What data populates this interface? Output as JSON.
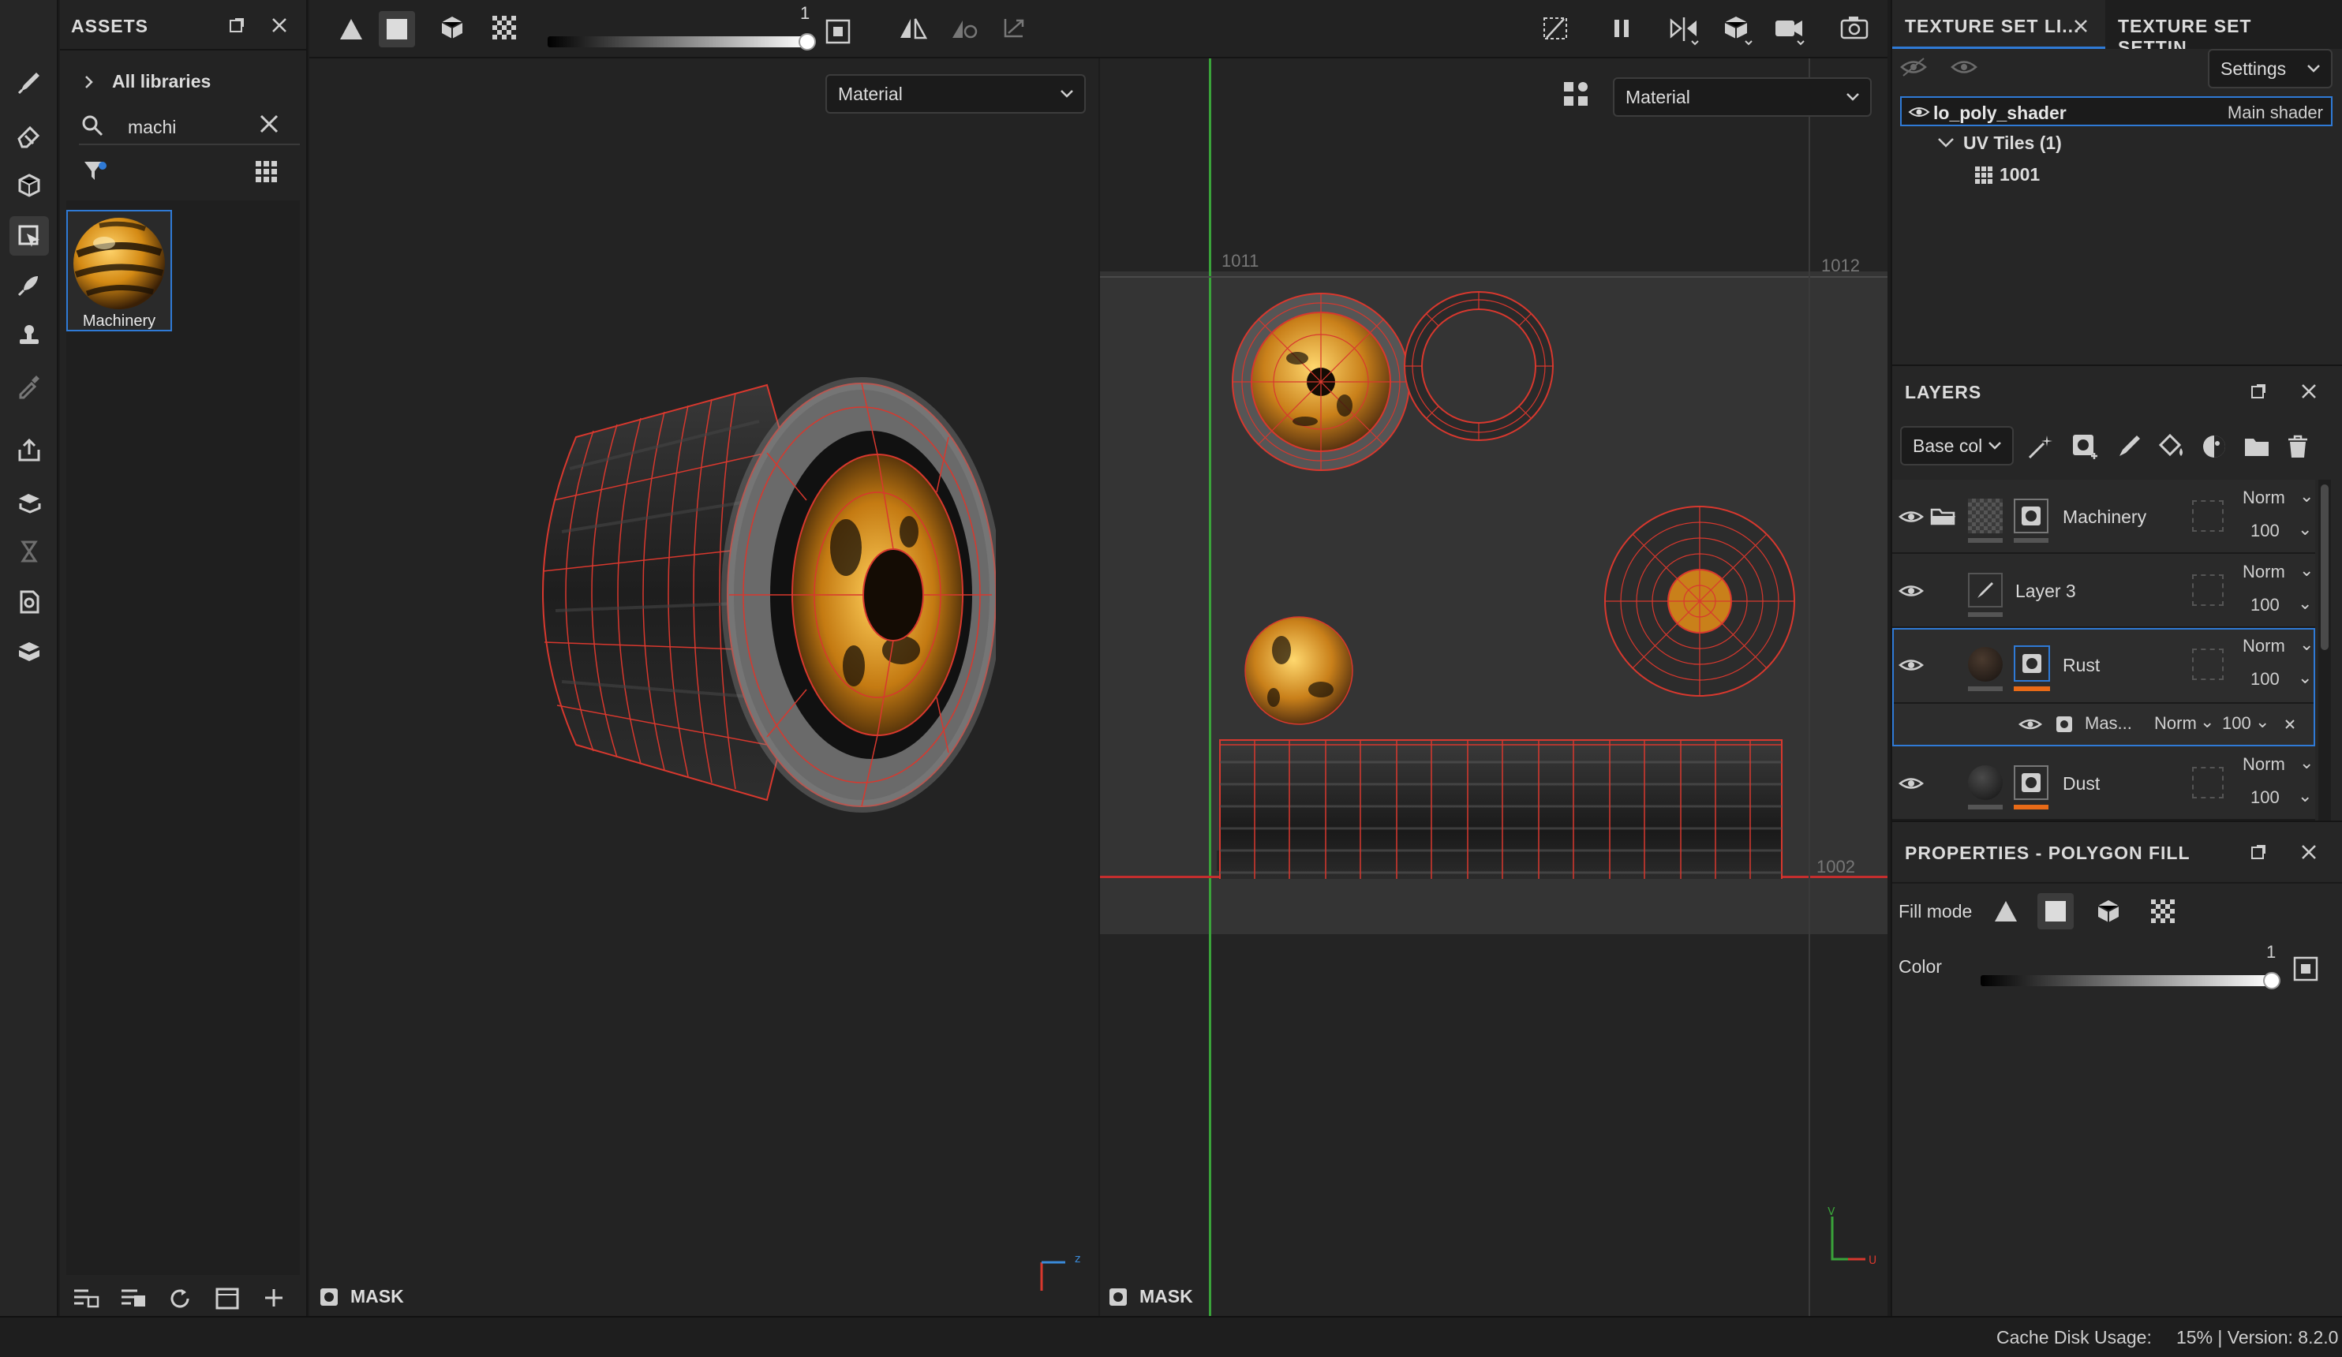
{
  "assets": {
    "title": "ASSETS",
    "breadcrumb": "All libraries",
    "search_value": "machi",
    "items": [
      {
        "label": "Machinery"
      }
    ]
  },
  "toolbar": {
    "slider_value": "1"
  },
  "viewport3d": {
    "mode": "Material",
    "mask_label": "MASK"
  },
  "viewport2d": {
    "mode": "Material",
    "mask_label": "MASK",
    "tile_labels": [
      "1011",
      "1012",
      "1001",
      "1002"
    ],
    "axis_v": "V",
    "axis_u": "U"
  },
  "texture_set": {
    "tabs": [
      "TEXTURE SET LI...",
      "TEXTURE SET SETTIN..."
    ],
    "settings_label": "Settings",
    "shader_name": "lo_poly_shader",
    "shader_type": "Main shader",
    "uv_tiles_label": "UV Tiles (1)",
    "tile": "1001"
  },
  "layers": {
    "title": "LAYERS",
    "channel": "Base col",
    "rows": [
      {
        "name": "Machinery",
        "blend": "Norm",
        "opacity": "100"
      },
      {
        "name": "Layer 3",
        "blend": "Norm",
        "opacity": "100"
      },
      {
        "name": "Rust",
        "blend": "Norm",
        "opacity": "100"
      },
      {
        "name": "Dust",
        "blend": "Norm",
        "opacity": "100"
      }
    ],
    "mask_row": {
      "name": "Mas...",
      "blend": "Norm",
      "opacity": "100"
    }
  },
  "properties": {
    "title": "PROPERTIES - POLYGON FILL",
    "fill_mode_label": "Fill mode",
    "color_label": "Color",
    "slider_value": "1"
  },
  "status": {
    "cache_label": "Cache Disk Usage:",
    "cache_value": "15% | Version: 8.2.0"
  },
  "colors": {
    "accent": "#2f7ad6",
    "wire": "#d8382e",
    "orange": "#e86a17",
    "gold": "#e5a12a"
  }
}
